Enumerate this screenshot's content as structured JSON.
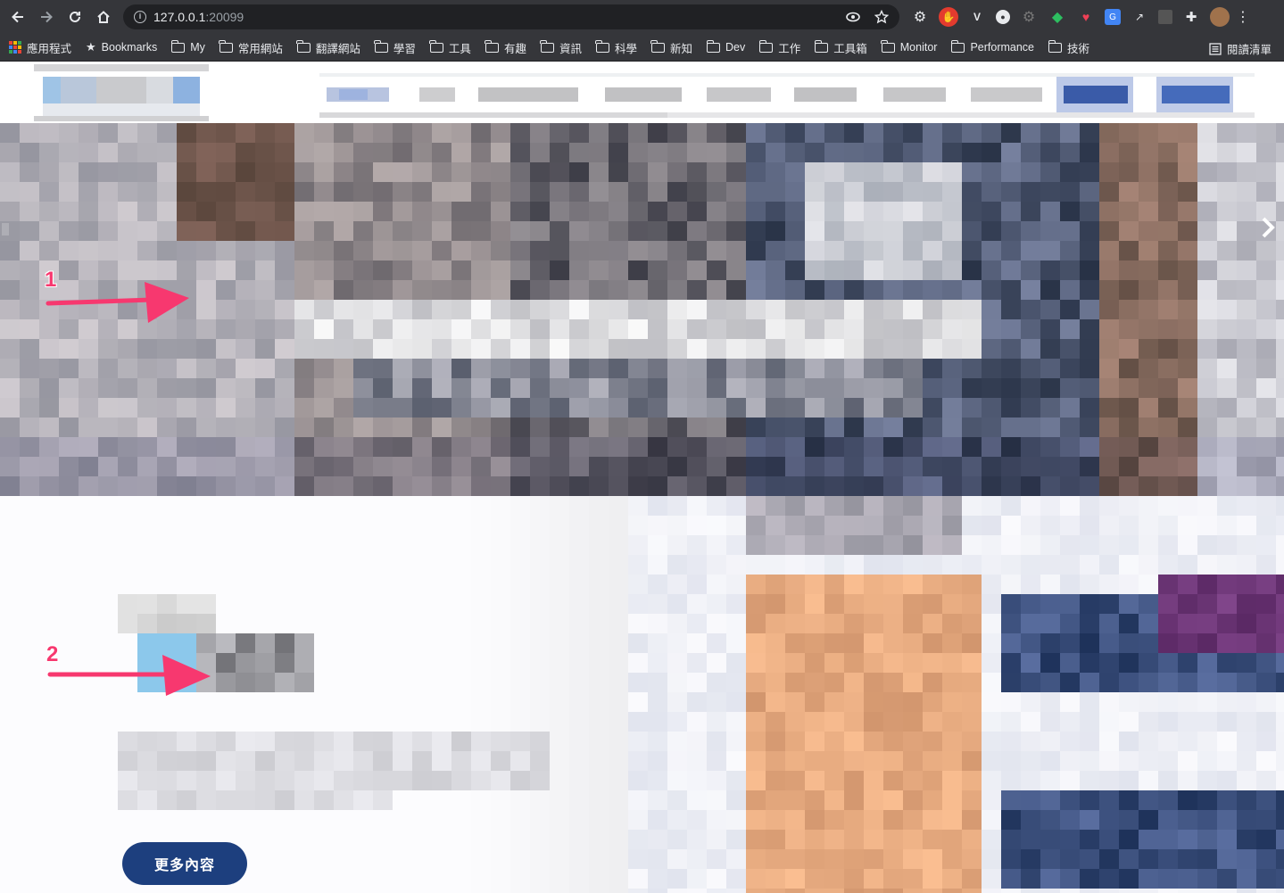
{
  "browser": {
    "url_host": "127.0.0.1",
    "url_port": ":20099",
    "bookmarks": [
      {
        "label": "應用程式",
        "icon": "apps-grid-icon"
      },
      {
        "label": "Bookmarks",
        "icon": "star-icon"
      },
      {
        "label": "My",
        "icon": "folder-icon"
      },
      {
        "label": "常用網站",
        "icon": "folder-icon"
      },
      {
        "label": "翻譯網站",
        "icon": "folder-icon"
      },
      {
        "label": "學習",
        "icon": "folder-icon"
      },
      {
        "label": "工具",
        "icon": "folder-icon"
      },
      {
        "label": "有趣",
        "icon": "folder-icon"
      },
      {
        "label": "資訊",
        "icon": "folder-icon"
      },
      {
        "label": "科學",
        "icon": "folder-icon"
      },
      {
        "label": "新知",
        "icon": "folder-icon"
      },
      {
        "label": "Dev",
        "icon": "folder-icon"
      },
      {
        "label": "工作",
        "icon": "folder-icon"
      },
      {
        "label": "工具箱",
        "icon": "folder-icon"
      },
      {
        "label": "Monitor",
        "icon": "folder-icon"
      },
      {
        "label": "Performance",
        "icon": "folder-icon"
      },
      {
        "label": "技術",
        "icon": "folder-icon"
      }
    ],
    "reading_list": "閱讀清單"
  },
  "page": {
    "cta_label": "更多內容",
    "annotations": [
      "1",
      "2"
    ]
  },
  "colors": {
    "chrome_bg": "#35363a",
    "omnibox_bg": "#202124",
    "cta_bg": "#1d3f7e",
    "annotation": "#f7386f"
  }
}
